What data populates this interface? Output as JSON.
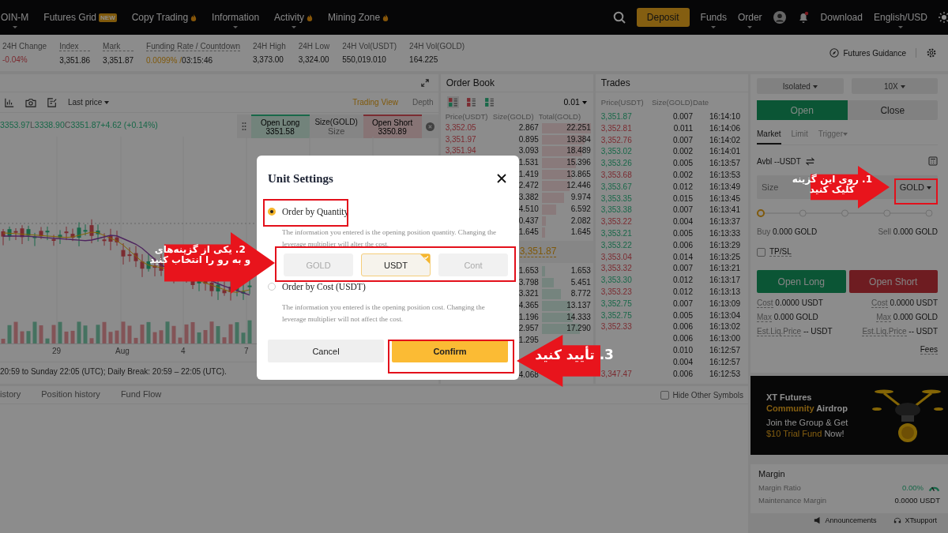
{
  "header": {
    "nav": [
      {
        "label": "OIN-M",
        "dropdown": true,
        "hot": false
      },
      {
        "label": "Futures Grid",
        "badge": "NEW",
        "dropdown": false,
        "hot": false
      },
      {
        "label": "Copy Trading",
        "dropdown": false,
        "hot": true
      },
      {
        "label": "Information",
        "dropdown": true,
        "hot": false
      },
      {
        "label": "Activity",
        "dropdown": true,
        "hot": true
      },
      {
        "label": "Mining Zone",
        "dropdown": false,
        "hot": true
      }
    ],
    "deposit": "Deposit",
    "menus": [
      {
        "label": "Funds",
        "dropdown": true
      },
      {
        "label": "Order",
        "dropdown": true
      }
    ],
    "notifications_unread": true,
    "download": "Download",
    "locale": "English/USD"
  },
  "stats": [
    {
      "label": "24H Change",
      "value": "-0.04%",
      "falling": true,
      "accent": false,
      "underlined": false
    },
    {
      "label": "Index",
      "value": "3,351.86",
      "falling": false,
      "accent": false,
      "underlined": true
    },
    {
      "label": "Mark",
      "value": "3,351.87",
      "falling": false,
      "accent": false,
      "underlined": true
    },
    {
      "label": "Funding Rate / Countdown",
      "value": "0.0099% /",
      "countdown": "03:15:46",
      "falling": false,
      "accent": true,
      "underlined": true
    },
    {
      "label": "24H High",
      "value": "3,373.00",
      "falling": false,
      "accent": false,
      "underlined": false
    },
    {
      "label": "24H Low",
      "value": "3,324.00",
      "falling": false,
      "accent": false,
      "underlined": false
    },
    {
      "label": "24H Vol(USDT)",
      "value": "550,019.010",
      "falling": false,
      "accent": false,
      "underlined": false
    },
    {
      "label": "24H Vol(GOLD)",
      "value": "164.225",
      "falling": false,
      "accent": false,
      "underlined": false
    }
  ],
  "guidance": "Futures Guidance",
  "chart": {
    "price_type": "Last price",
    "views": [
      {
        "label": "Trading View",
        "selected": true
      },
      {
        "label": "Depth",
        "selected": false
      }
    ],
    "ohlc": [
      {
        "value": "3353.97"
      },
      {
        "label": "L",
        "value": "3338.90"
      },
      {
        "label": "C",
        "value": "3351.87"
      },
      {
        "value": "+4.62 (+0.14%)"
      }
    ],
    "quick_order": {
      "long_label": "Open Long",
      "long_price": "3351.58",
      "size_label": "Size(GOLD)",
      "size_placeholder": "Size",
      "short_label": "Open Short",
      "short_price": "3350.89"
    },
    "x_labels": [
      "29",
      "Aug",
      "4",
      "7"
    ],
    "trading_hours": "20:59 to Sunday 22:05 (UTC); Daily Break: 20:59 – 22:05 (UTC)."
  },
  "bottom_tabs": [
    {
      "label": "istory",
      "selected": false
    },
    {
      "label": "Position history",
      "selected": false
    },
    {
      "label": "Fund Flow",
      "selected": false
    }
  ],
  "hide_other_symbols": {
    "label": "Hide Other Symbols",
    "checked": false
  },
  "order_book": {
    "title": "Order Book",
    "precision": "0.01",
    "layouts": [
      {
        "kind": "both",
        "selected": true
      },
      {
        "kind": "asks",
        "selected": false
      },
      {
        "kind": "bids",
        "selected": false
      }
    ],
    "columns": [
      "Price(USDT)",
      "Size(GOLD)",
      "Total(GOLD)"
    ],
    "asks": [
      {
        "price": "3,352.05",
        "size": "2.867",
        "total": "22.251"
      },
      {
        "price": "3,351.97",
        "size": "0.895",
        "total": "19.384"
      },
      {
        "price": "3,351.94",
        "size": "3.093",
        "total": "18.489"
      },
      {
        "size": "1.531",
        "total": "15.396"
      },
      {
        "size": "1.419",
        "total": "13.865"
      },
      {
        "size": "2.472",
        "total": "12.446"
      },
      {
        "size": "3.382",
        "total": "9.974"
      },
      {
        "size": "4.510",
        "total": "6.592"
      },
      {
        "size": "0.437",
        "total": "2.082"
      },
      {
        "size": "1.645",
        "total": "1.645"
      }
    ],
    "last_price": "3,351.87",
    "bids": [
      {
        "size": "1.653",
        "total": "1.653"
      },
      {
        "size": "3.798",
        "total": "5.451"
      },
      {
        "size": "3.321",
        "total": "8.772"
      },
      {
        "size": "4.365",
        "total": "13.137"
      },
      {
        "size": "1.196",
        "total": "14.333"
      },
      {
        "size": "2.957",
        "total": "17.290"
      },
      {
        "size": "1.295"
      },
      {
        "size": "4.068"
      }
    ]
  },
  "trades": {
    "title": "Trades",
    "columns": [
      "Price(USDT)",
      "Size(GOLD)",
      "Date"
    ],
    "rows": [
      {
        "price": "3,351.87",
        "up": true,
        "size": "0.007",
        "time": "16:14:10"
      },
      {
        "price": "3,352.81",
        "up": false,
        "size": "0.011",
        "time": "16:14:06"
      },
      {
        "price": "3,352.76",
        "up": false,
        "size": "0.007",
        "time": "16:14:02"
      },
      {
        "price": "3,353.02",
        "up": true,
        "size": "0.002",
        "time": "16:14:01"
      },
      {
        "price": "3,353.26",
        "up": true,
        "size": "0.005",
        "time": "16:13:57"
      },
      {
        "price": "3,353.68",
        "up": false,
        "size": "0.002",
        "time": "16:13:53"
      },
      {
        "price": "3,353.67",
        "up": true,
        "size": "0.012",
        "time": "16:13:49"
      },
      {
        "price": "3,353.35",
        "up": true,
        "size": "0.015",
        "time": "16:13:45"
      },
      {
        "price": "3,353.38",
        "up": true,
        "size": "0.007",
        "time": "16:13:41"
      },
      {
        "price": "3,353.22",
        "up": false,
        "size": "0.004",
        "time": "16:13:37"
      },
      {
        "price": "3,353.21",
        "up": true,
        "size": "0.005",
        "time": "16:13:33"
      },
      {
        "price": "3,353.22",
        "up": true,
        "size": "0.006",
        "time": "16:13:29"
      },
      {
        "price": "3,353.04",
        "up": false,
        "size": "0.014",
        "time": "16:13:25"
      },
      {
        "price": "3,353.32",
        "up": false,
        "size": "0.007",
        "time": "16:13:21"
      },
      {
        "price": "3,353.30",
        "up": true,
        "size": "0.012",
        "time": "16:13:17"
      },
      {
        "price": "3,353.23",
        "up": false,
        "size": "0.012",
        "time": "16:13:13"
      },
      {
        "price": "3,352.75",
        "up": true,
        "size": "0.007",
        "time": "16:13:09"
      },
      {
        "price": "3,352.75",
        "up": true,
        "size": "0.005",
        "time": "16:13:04"
      },
      {
        "price": "3,352.33",
        "up": false,
        "size": "0.006",
        "time": "16:13:02"
      },
      {
        "size": "0.006",
        "time": "16:13:00"
      },
      {
        "size": "0.010",
        "time": "16:12:57"
      },
      {
        "size": "0.004",
        "time": "16:12:57"
      },
      {
        "price": "3,347.47",
        "up": false,
        "size": "0.006",
        "time": "16:12:53"
      }
    ]
  },
  "trade_panel": {
    "margin_mode": "Isolated",
    "leverage": "10X",
    "sides": [
      {
        "label": "Open",
        "selected": true
      },
      {
        "label": "Close",
        "selected": false
      }
    ],
    "order_types": [
      {
        "label": "Market",
        "selected": true,
        "dropdown": false
      },
      {
        "label": "Limit",
        "selected": false,
        "dropdown": false
      },
      {
        "label": "Trigger",
        "selected": false,
        "dropdown": true
      }
    ],
    "available": "Avbl --USDT",
    "size_placeholder": "Size",
    "unit": "GOLD",
    "slider": {
      "level": 0
    },
    "buy": {
      "label": "Buy",
      "value": "0.000 GOLD"
    },
    "sell": {
      "label": "Sell",
      "value": "0.000 GOLD"
    },
    "tpsl": {
      "label": "TP/SL",
      "checked": false
    },
    "open_long": "Open Long",
    "open_short": "Open Short",
    "details": [
      {
        "left": {
          "label": "Cost",
          "value": "0.0000 USDT"
        },
        "right": {
          "label": "Cost",
          "value": "0.0000 USDT"
        }
      },
      {
        "left": {
          "label": "Max",
          "value": "0.000 GOLD"
        },
        "right": {
          "label": "Max",
          "value": "0.000 GOLD"
        }
      },
      {
        "left": {
          "label": "Est.Liq.Price",
          "value": "-- USDT"
        },
        "right": {
          "label": "Est.Liq.Price",
          "value": "-- USDT"
        }
      }
    ],
    "fees": "Fees"
  },
  "banner": {
    "lines": [
      [
        {
          "text": "XT Futures",
          "accent": false
        }
      ],
      [
        {
          "text": "Community ",
          "accent": true
        },
        {
          "text": "Airdrop",
          "accent": false
        }
      ],
      [
        {
          "text": "Join the Group & Get",
          "accent": false
        }
      ],
      [
        {
          "text": "$10 Trial Fund",
          "accent": true
        },
        {
          "text": " Now!",
          "accent": false
        }
      ]
    ]
  },
  "margin": {
    "title": "Margin",
    "ratio_label": "Margin Ratio",
    "ratio": "0.00%",
    "maintenance_label": "Maintenance Margin",
    "maintenance": "0.0000 USDT"
  },
  "footer": {
    "announcements": "Announcements",
    "support": "XTsupport"
  },
  "modal": {
    "title": "Unit Settings",
    "options": [
      {
        "label": "Order by Quantity",
        "selected": true,
        "description": "The information you entered is the opening position quantity. Changing the leverage multiplier will alter the cost.",
        "units": [
          {
            "label": "GOLD",
            "selected": false
          },
          {
            "label": "USDT",
            "selected": true
          },
          {
            "label": "Cont",
            "selected": false
          }
        ]
      },
      {
        "label": "Order by Cost (USDT)",
        "selected": false,
        "description": "The information you entered is the opening position cost. Changing the leverage multiplier will not affect the cost."
      }
    ],
    "cancel": "Cancel",
    "confirm": "Confirm"
  },
  "annotations": [
    {
      "kind": "right",
      "lines": [
        "1. روی این گزینه",
        "کلیک کنید"
      ]
    },
    {
      "kind": "right",
      "lines": [
        "2. یکی از گزینه‌های",
        "و به رو را انتخاب کنید"
      ]
    },
    {
      "kind": "left",
      "lines": [
        "3. تأیید کنید"
      ]
    }
  ]
}
